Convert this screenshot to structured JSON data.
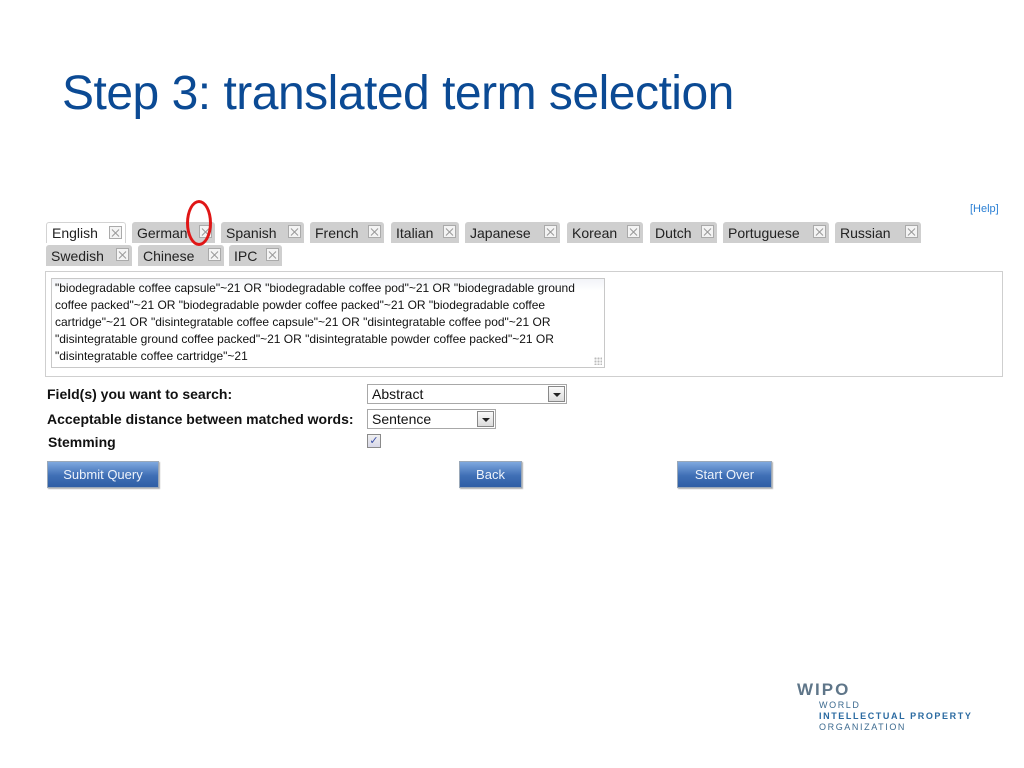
{
  "slide": {
    "title": "Step 3: translated term selection"
  },
  "help_link": "[Help]",
  "language_tabs": [
    {
      "label": "English",
      "active": true
    },
    {
      "label": "German",
      "active": false
    },
    {
      "label": "Spanish",
      "active": false
    },
    {
      "label": "French",
      "active": false
    },
    {
      "label": "Italian",
      "active": false
    },
    {
      "label": "Japanese",
      "active": false
    },
    {
      "label": "Korean",
      "active": false
    },
    {
      "label": "Dutch",
      "active": false
    },
    {
      "label": "Portuguese",
      "active": false
    },
    {
      "label": "Russian",
      "active": false
    },
    {
      "label": "Swedish",
      "active": false
    },
    {
      "label": "Chinese",
      "active": false
    },
    {
      "label": "IPC",
      "active": false
    }
  ],
  "annotation": {
    "target": "German tab close icon",
    "color": "#e01616"
  },
  "query": {
    "value": "\"biodegradable coffee capsule\"~21 OR \"biodegradable coffee pod\"~21 OR \"biodegradable ground coffee packed\"~21 OR \"biodegradable powder coffee packed\"~21 OR \"biodegradable coffee cartridge\"~21 OR \"disintegratable coffee capsule\"~21 OR \"disintegratable coffee pod\"~21 OR \"disintegratable ground coffee packed\"~21 OR \"disintegratable powder coffee packed\"~21 OR \"disintegratable coffee cartridge\"~21"
  },
  "form": {
    "fields_label": "Field(s) you want to search:",
    "fields_value": "Abstract",
    "distance_label": "Acceptable distance between matched words:",
    "distance_value": "Sentence",
    "stemming_label": "Stemming",
    "stemming_checked": true,
    "check_glyph": "✓"
  },
  "buttons": {
    "submit": "Submit Query",
    "back": "Back",
    "start_over": "Start Over"
  },
  "logo": {
    "mark": "WIPO",
    "line1": "WORLD",
    "line2": "INTELLECTUAL PROPERTY",
    "line3": "ORGANIZATION"
  },
  "colors": {
    "title": "#0b4a94",
    "button": "#3f6fb5",
    "help_link": "#2a7fd4"
  }
}
